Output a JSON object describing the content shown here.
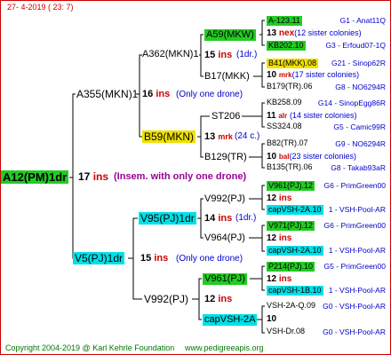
{
  "header": {
    "date": "27-   4-2019  (  23:   7)"
  },
  "footer": {
    "copyright": "Copyright 2004-2019 @ Karl Kehrle Foundation",
    "site": "www.pedigreeapis.org"
  },
  "root": {
    "label": "A12(PM)1dr",
    "num": "17",
    "ins": "ins",
    "note": "(Insem. with only one drone)"
  },
  "g1": [
    {
      "label": "A355(MKN)1",
      "num": "16",
      "ins": "ins",
      "note": "(Only one drone)"
    },
    {
      "label": "V5(PJ)1dr",
      "num": "15",
      "ins": "ins",
      "note": "(Only one drone)"
    }
  ],
  "g2": [
    {
      "label": "A362(MKN)1",
      "num": "15",
      "ins": "ins",
      "note": "(1dr.)"
    },
    {
      "label": "B59(MKN)",
      "num": "13",
      "ins": "mrk",
      "note": "(24 c.)"
    },
    {
      "label": "V95(PJ)1dr",
      "num": "14",
      "ins": "ins",
      "note": "(1dr.)"
    },
    {
      "label": "V992(PJ)",
      "num": "12",
      "ins": "ins"
    }
  ],
  "g3": [
    {
      "label": "A59(MKW)",
      "num": "13",
      "ins": "nex",
      "note": "(12 sister colonies)"
    },
    {
      "label": "B17(MKK)",
      "num": "10",
      "ins": "mrk",
      "note": "(17 sister colonies)"
    },
    {
      "label": "ST206",
      "num": "11",
      "ins": "alr",
      "note": "(14 sister colonies)"
    },
    {
      "label": "B129(TR)",
      "num": "10",
      "ins": "bal",
      "note": "(23 sister colonies)"
    },
    {
      "label": "V992(PJ)",
      "num": "12",
      "ins": "ins"
    },
    {
      "label": "V964(PJ)",
      "num": "12",
      "ins": "ins"
    },
    {
      "label": "V961(PJ)",
      "num": "12",
      "ins": "ins"
    },
    {
      "label": "capVSH-2A",
      "num": "10"
    }
  ],
  "g4": [
    {
      "label": "A-123.11",
      "info": "G1 - Anat11Q"
    },
    {
      "label": "KB202.10",
      "info": "G3 - Erfoud07-1Q"
    },
    {
      "label": "B41(MKK).08",
      "info": "G21 - Sinop62R"
    },
    {
      "label": "B179(TR).06",
      "info": "G8 - NO6294R"
    },
    {
      "label": "KB258.09",
      "info": "G14 - SinopEgg86R"
    },
    {
      "label": "SS324.08",
      "info": "G5 - Camic99R"
    },
    {
      "label": "B82(TR).07",
      "info": "G9 - NO6294R"
    },
    {
      "label": "B135(TR).06",
      "info": "G8 - Takab93aR"
    },
    {
      "label": "V961(PJ).12",
      "info": "G6 - PrimGreen00"
    },
    {
      "label": "capVSH-2A.10",
      "info": "1 - VSH-Pool-AR"
    },
    {
      "label": "V971(PJ).12",
      "info": "G6 - PrimGreen00"
    },
    {
      "label": "capVSH-2A.10",
      "info": "1 - VSH-Pool-AR"
    },
    {
      "label": "P214(PJ).10",
      "info": "G5 - PrimGreen00"
    },
    {
      "label": "capVSH-1B.10",
      "info": "1 - VSH-Pool-AR"
    },
    {
      "label": "VSH-2A-Q.09",
      "info": "G0 - VSH-Pool-AR"
    },
    {
      "label": "VSH-Dr.08",
      "info": "G0 - VSH-Pool-AR"
    }
  ],
  "colors": {
    "frame": "#cc0000",
    "green": "#22cc22",
    "lime": "#66ee00",
    "yellow": "#f0e000",
    "cyan": "#00e0e8",
    "blue": "#0000cc",
    "red": "#cc0000"
  }
}
